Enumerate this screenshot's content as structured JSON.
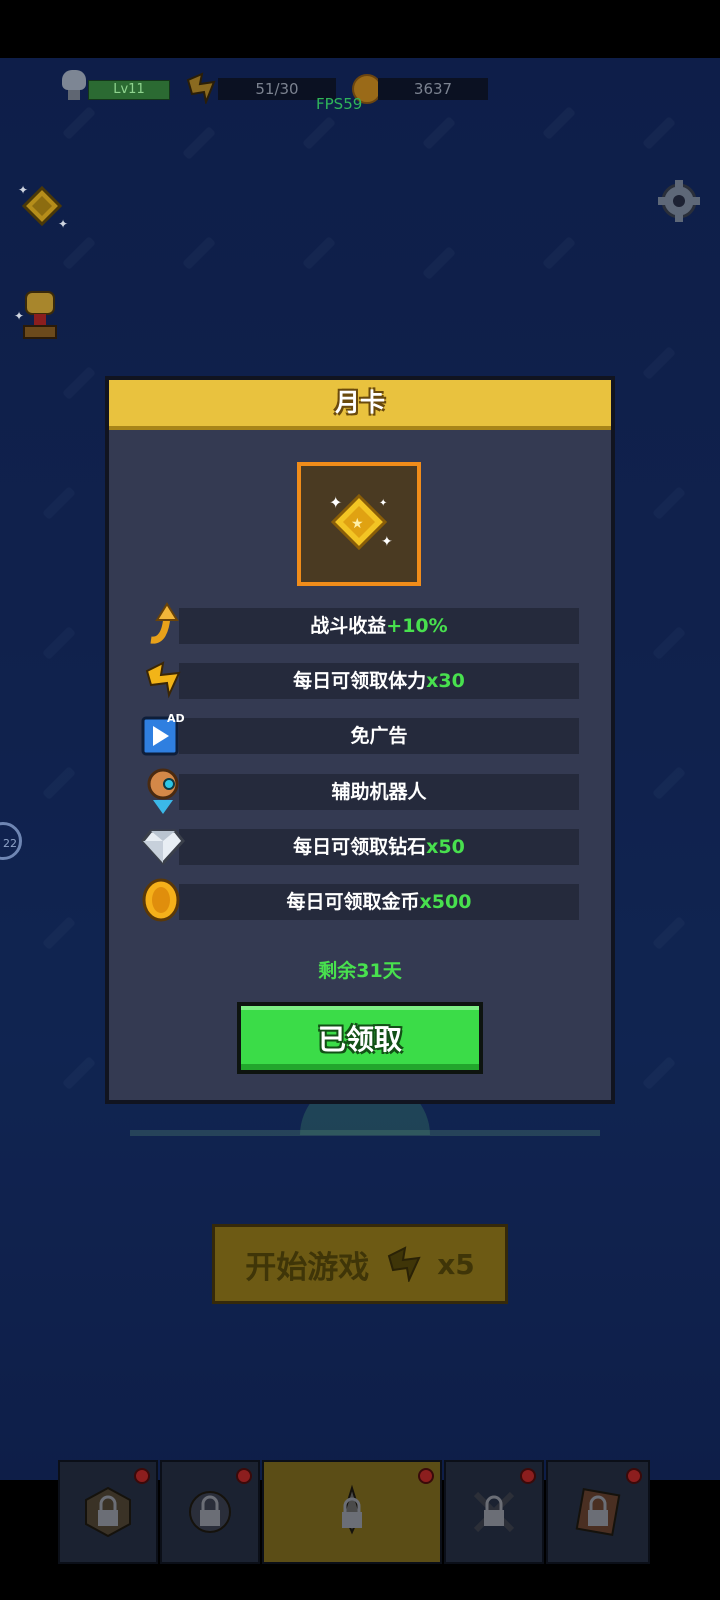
{
  "hud": {
    "level": "Lv11",
    "energy": "51/30",
    "coins": "3637",
    "fps": "FPS59"
  },
  "side": {
    "badge": "22"
  },
  "main": {
    "start_label": "开始游戏",
    "start_cost": "x5"
  },
  "nav": {
    "tabs": [
      {
        "name": "tab-1",
        "locked": true
      },
      {
        "name": "tab-2",
        "locked": true
      },
      {
        "name": "tab-3",
        "locked": true,
        "active": true
      },
      {
        "name": "tab-4",
        "locked": true
      },
      {
        "name": "tab-5",
        "locked": true
      }
    ]
  },
  "modal": {
    "title": "月卡",
    "benefits": [
      {
        "text": "战斗收益",
        "highlight": "+10%",
        "icon": "arrow-up-icon"
      },
      {
        "text": "每日可领取体力",
        "highlight": "x30",
        "icon": "energy-bolt-icon"
      },
      {
        "text": "免广告",
        "highlight": "",
        "icon": "ad-play-icon"
      },
      {
        "text": "辅助机器人",
        "highlight": "",
        "icon": "robot-icon"
      },
      {
        "text": "每日可领取钻石",
        "highlight": "x50",
        "icon": "diamond-icon"
      },
      {
        "text": "每日可领取金币",
        "highlight": "x500",
        "icon": "coin-icon"
      }
    ],
    "remaining": "剩余31天",
    "claim_label": "已领取",
    "ad_label": "AD"
  },
  "colors": {
    "highlight_green": "#48e04e",
    "header_yellow": "#e9c23e",
    "panel": "#343a52",
    "claim_button": "#3bdc48"
  }
}
